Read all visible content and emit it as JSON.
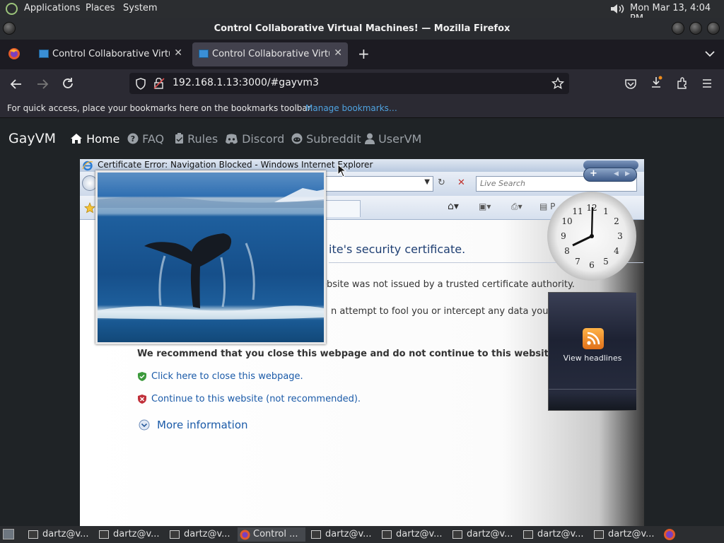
{
  "top_panel": {
    "menus": [
      "Applications",
      "Places",
      "System"
    ],
    "clock": "Mon Mar 13,  4:04 PM"
  },
  "window": {
    "title": "Control Collaborative Virtual Machines! — Mozilla Firefox"
  },
  "tabs": [
    {
      "label": "Control Collaborative Virtual Machines!",
      "close": "✕"
    },
    {
      "label": "Control Collaborative Virtual Machines!",
      "close": "✕"
    }
  ],
  "new_tab": "+",
  "url": "192.168.1.13:3000/#gayvm3",
  "bookmarks_bar": {
    "text": "For quick access, place your bookmarks here on the bookmarks toolbar.",
    "link": "Manage bookmarks…"
  },
  "site_nav": {
    "brand": "GayVM",
    "items": [
      "Home",
      "FAQ",
      "Rules",
      "Discord",
      "Subreddit",
      "UserVM"
    ]
  },
  "vm": {
    "ie_title": "Certificate Error: Navigation Blocked - Windows Internet Explorer",
    "search_placeholder": "Live Search",
    "page_heading_fragment": "ite's security certificate.",
    "line1_fragment": "ebsite was not issued by a trusted certificate authority.",
    "line2_fragment": "n attempt to fool you or intercept any data you send",
    "recommend": "We recommend that you close this webpage and do not continue to this website.",
    "close_link": "Click here to close this webpage.",
    "continue_link": "Continue to this website (not recommended).",
    "more_info": "More information",
    "headlines_label": "View headlines",
    "clock_numbers": [
      "12",
      "1",
      "2",
      "3",
      "4",
      "5",
      "6",
      "7",
      "8",
      "9",
      "10",
      "11"
    ]
  },
  "taskbar": [
    {
      "label": "dartz@v...",
      "icon": "terminal-icon"
    },
    {
      "label": "dartz@v...",
      "icon": "terminal-icon"
    },
    {
      "label": "dartz@v...",
      "icon": "terminal-icon"
    },
    {
      "label": "Control ...",
      "icon": "firefox-icon"
    },
    {
      "label": "dartz@v...",
      "icon": "terminal-icon"
    },
    {
      "label": "dartz@v...",
      "icon": "terminal-icon"
    },
    {
      "label": "dartz@v...",
      "icon": "terminal-icon"
    },
    {
      "label": "dartz@v...",
      "icon": "terminal-icon"
    },
    {
      "label": "dartz@v...",
      "icon": "terminal-icon"
    }
  ],
  "colors": {
    "accent_link": "#4fa3e0",
    "vm_link": "#1a5aa8"
  }
}
